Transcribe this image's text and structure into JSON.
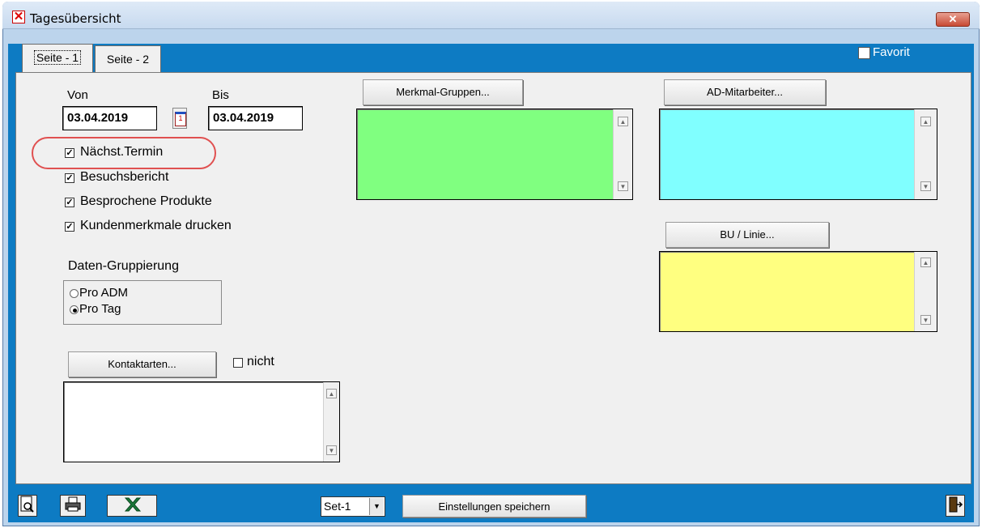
{
  "window": {
    "title": "Tagesübersicht",
    "close_glyph": "✕"
  },
  "tabs": [
    {
      "label": "Seite - 1"
    },
    {
      "label": "Seite - 2"
    }
  ],
  "favorit": {
    "label": "Favorit",
    "checked": false
  },
  "dates": {
    "von_label": "Von",
    "bis_label": "Bis",
    "von_value": "03.04.2019",
    "bis_value": "03.04.2019"
  },
  "options": [
    {
      "label": "Nächst.Termin",
      "checked": true
    },
    {
      "label": "Besuchsbericht",
      "checked": true
    },
    {
      "label": "Besprochene Produkte",
      "checked": true
    },
    {
      "label": "Kundenmerkmale drucken",
      "checked": true
    }
  ],
  "grouping": {
    "title": "Daten-Gruppierung",
    "choices": [
      {
        "label": "Pro ADM",
        "selected": false
      },
      {
        "label": "Pro Tag",
        "selected": true
      }
    ]
  },
  "kontakt": {
    "button": "Kontaktarten...",
    "nicht_label": "nicht",
    "nicht_checked": false
  },
  "merkmal": {
    "button": "Merkmal-Gruppen...",
    "color": "#80ff80"
  },
  "ad": {
    "button": "AD-Mitarbeiter...",
    "color": "#80ffff"
  },
  "bu": {
    "button": "BU / Linie...",
    "color": "#ffff80"
  },
  "bottom": {
    "set_value": "Set-1",
    "save_button": "Einstellungen speichern"
  },
  "icons": [
    "preview-icon",
    "print-icon",
    "excel-icon",
    "exit-icon",
    "calendar-icon"
  ]
}
